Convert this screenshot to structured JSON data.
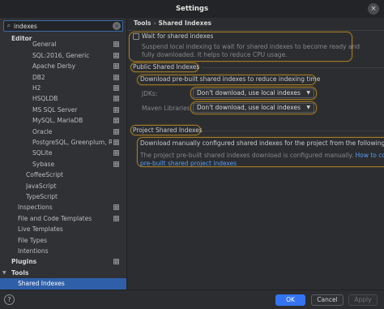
{
  "window": {
    "title": "Settings",
    "close_label": "×"
  },
  "search": {
    "value": "indexes"
  },
  "tree": {
    "items": [
      {
        "label": "Editor",
        "bold": true,
        "db": false
      },
      {
        "label": "General",
        "db": true
      },
      {
        "label": "SQL:2016, Generic",
        "db": true
      },
      {
        "label": "Apache Derby",
        "db": true
      },
      {
        "label": "DB2",
        "db": true
      },
      {
        "label": "H2",
        "db": true
      },
      {
        "label": "HSQLDB",
        "db": true
      },
      {
        "label": "MS SQL Server",
        "db": true
      },
      {
        "label": "MySQL, MariaDB",
        "db": true
      },
      {
        "label": "Oracle",
        "db": true
      },
      {
        "label": "PostgreSQL, Greenplum, Rec",
        "db": true
      },
      {
        "label": "SQLite",
        "db": true
      },
      {
        "label": "Sybase",
        "db": true
      },
      {
        "label": "CoffeeScript",
        "db": false
      },
      {
        "label": "JavaScript",
        "db": false
      },
      {
        "label": "TypeScript",
        "db": false
      },
      {
        "label": "Inspections",
        "db": true
      },
      {
        "label": "File and Code Templates",
        "db": true
      },
      {
        "label": "Live Templates",
        "db": false
      },
      {
        "label": "File Types",
        "db": false
      },
      {
        "label": "Intentions",
        "db": false
      },
      {
        "label": "Plugins",
        "bold": true,
        "db": true
      },
      {
        "label": "Tools",
        "bold": true,
        "db": false
      },
      {
        "label": "Shared Indexes",
        "db": false,
        "selected": true
      }
    ]
  },
  "breadcrumb": {
    "parent": "Tools",
    "separator": "›",
    "current": "Shared Indexes"
  },
  "content": {
    "wait_checkbox_label": "Wait for shared indexes",
    "wait_desc_line1": "Suspend local indexing to wait for shared indexes to become ready and",
    "wait_desc_line2": "fully downloaded. It helps to reduce CPU usage.",
    "public_section": "Public Shared Indexes",
    "public_desc": "Download pre-built shared indexes to reduce indexing time",
    "jdks_label": "JDKs:",
    "jdks_value": "Don't download, use local indexes",
    "maven_label": "Maven Libraries:",
    "maven_value": "Don't download, use local indexes",
    "project_section": "Project Shared Indexes",
    "project_desc": "Download manually configured shared indexes for the project from the following loc",
    "project_note_prefix": "The project pre-built shared indexes download is configured manually.",
    "project_note_link1": "How to configu",
    "project_note_link2": "pre-built shared project indexes"
  },
  "footer": {
    "help": "?",
    "ok": "OK",
    "cancel": "Cancel",
    "apply": "Apply"
  },
  "colors": {
    "accent": "#3574f0",
    "selection": "#2f5fa8",
    "highlight": "#a07a28",
    "link": "#589df6"
  }
}
